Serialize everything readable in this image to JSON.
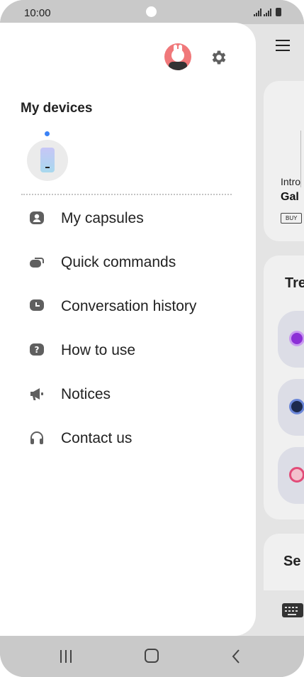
{
  "status_bar": {
    "time": "10:00"
  },
  "drawer": {
    "section_title": "My devices",
    "menu": [
      {
        "label": "My capsules",
        "icon": "person-card-icon"
      },
      {
        "label": "Quick commands",
        "icon": "quick-commands-icon"
      },
      {
        "label": "Conversation history",
        "icon": "history-icon"
      },
      {
        "label": "How to use",
        "icon": "help-icon"
      },
      {
        "label": "Notices",
        "icon": "megaphone-icon"
      },
      {
        "label": "Contact us",
        "icon": "headset-icon"
      }
    ]
  },
  "background": {
    "intro_text": "Intro",
    "gal_text": "Gal",
    "buy_text": "BUY",
    "tre_text": "Tre",
    "se_text": "Se"
  },
  "colors": {
    "accent_dot": "#3b82f6",
    "avatar_bg": "#f0787a"
  }
}
